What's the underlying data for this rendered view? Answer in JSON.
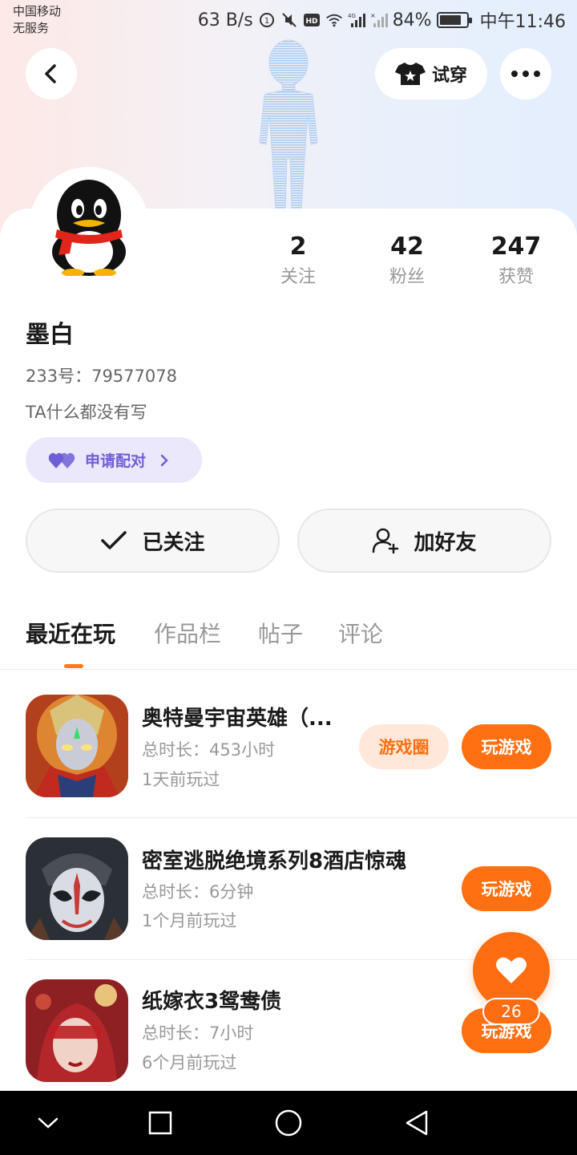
{
  "status_bar": {
    "carrier_line1": "中国移动",
    "carrier_line2": "无服务",
    "net_speed": "63 B/s",
    "battery_percent": "84%",
    "battery_level": 0.84,
    "time": "中午11:46",
    "icons": [
      "data-saver-icon",
      "mute-icon",
      "hd-icon",
      "wifi-icon",
      "4g-signal-icon",
      "no-signal-icon"
    ]
  },
  "header": {
    "try_on_label": "试穿",
    "icons": [
      "back-icon",
      "shirt-icon",
      "more-icon"
    ]
  },
  "profile": {
    "name": "墨白",
    "uid": "233号：79577078",
    "bio": "TA什么都没有写",
    "pair_label": "申请配对",
    "stats": [
      {
        "num": "2",
        "label": "关注"
      },
      {
        "num": "42",
        "label": "粉丝"
      },
      {
        "num": "247",
        "label": "获赞"
      }
    ]
  },
  "actions": {
    "followed_label": "已关注",
    "add_friend_label": "加好友"
  },
  "tabs": [
    {
      "label": "最近在玩",
      "active": true
    },
    {
      "label": "作品栏",
      "active": false
    },
    {
      "label": "帖子",
      "active": false
    },
    {
      "label": "评论",
      "active": false
    }
  ],
  "games": [
    {
      "title": "奥特曼宇宙英雄（...",
      "duration": "总时长：453小时",
      "last_played": "1天前玩过",
      "circle_label": "游戏圈",
      "play_label": "玩游戏"
    },
    {
      "title": "密室逃脱绝境系列8酒店惊魂",
      "duration": "总时长：6分钟",
      "last_played": "1个月前玩过",
      "play_label": "玩游戏"
    },
    {
      "title": "纸嫁衣3鸳鸯债",
      "duration": "总时长：7小时",
      "last_played": "6个月前玩过",
      "play_label": "玩游戏"
    }
  ],
  "fab": {
    "count": "26"
  },
  "colors": {
    "accent": "#ff7012",
    "pair": "#6f5fd6"
  }
}
